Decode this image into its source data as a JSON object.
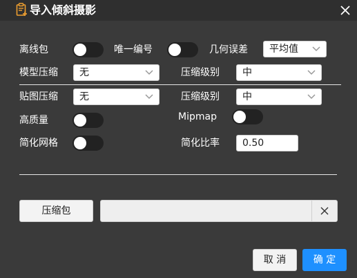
{
  "title": "导入倾斜摄影",
  "icons": {
    "title": "document-edit-icon",
    "close": "close-icon",
    "chevron": "chevron-down-icon",
    "clear": "clear-icon"
  },
  "row1": {
    "lixianbao_label": "离线包",
    "lixianbao_on": false,
    "weiyi_label": "唯一编号",
    "weiyi_on": false,
    "error_label": "几何误差",
    "error_value": "平均值"
  },
  "row2": {
    "model_label": "模型压缩",
    "model_value": "无",
    "level_label": "压缩级别",
    "level_value": "中"
  },
  "row3": {
    "texture_label": "贴图压缩",
    "texture_value": "无",
    "level_label": "压缩级别",
    "level_value": "中"
  },
  "row4": {
    "hq_label": "高质量",
    "hq_on": false,
    "mipmap_label": "Mipmap",
    "mipmap_on": false
  },
  "row5": {
    "simplify_label": "简化网格",
    "simplify_on": false,
    "ratio_label": "简化比率",
    "ratio_value": "0.50"
  },
  "package": {
    "button_label": "压缩包",
    "path_value": ""
  },
  "footer": {
    "cancel_label": "取 消",
    "ok_label": "确 定"
  },
  "colors": {
    "background": "#3a3a3a",
    "titlebar": "#2f2f2f",
    "primary": "#1e90ff",
    "toggle_off": "#222222"
  }
}
